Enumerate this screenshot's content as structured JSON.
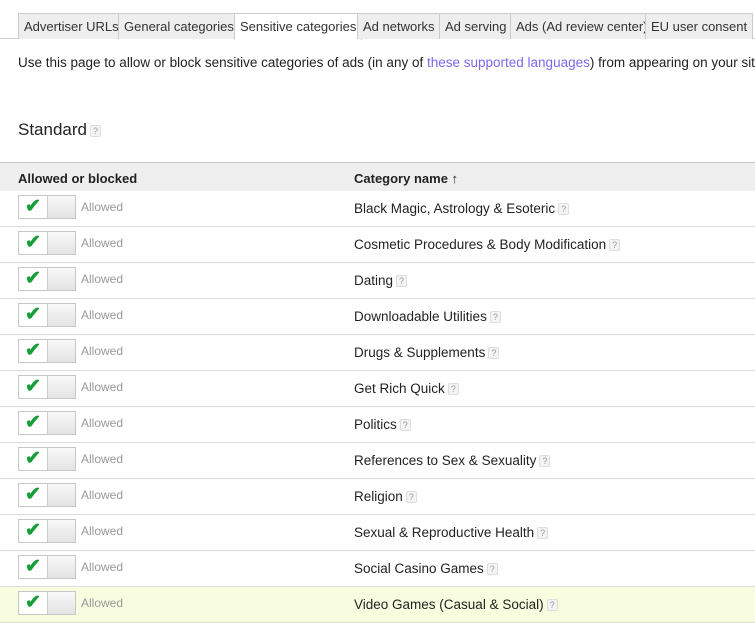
{
  "tabs": [
    {
      "label": "Advertiser URLs",
      "active": false
    },
    {
      "label": "General categories",
      "active": false
    },
    {
      "label": "Sensitive categories",
      "active": true
    },
    {
      "label": "Ad networks",
      "active": false
    },
    {
      "label": "Ad serving",
      "active": false
    },
    {
      "label": "Ads (Ad review center)",
      "active": false
    },
    {
      "label": "EU user consent",
      "active": false
    }
  ],
  "intro": {
    "before": "Use this page to allow or block sensitive categories of ads (in any of ",
    "link": "these supported languages",
    "after": ") from appearing on your site."
  },
  "section_title": "Standard",
  "help_glyph": "?",
  "table": {
    "col_status": "Allowed or blocked",
    "col_category": "Category name",
    "sort_arrow": "↑",
    "rows": [
      {
        "status": "Allowed",
        "category": "Black Magic, Astrology & Esoteric"
      },
      {
        "status": "Allowed",
        "category": "Cosmetic Procedures & Body Modification"
      },
      {
        "status": "Allowed",
        "category": "Dating"
      },
      {
        "status": "Allowed",
        "category": "Downloadable Utilities"
      },
      {
        "status": "Allowed",
        "category": "Drugs & Supplements"
      },
      {
        "status": "Allowed",
        "category": "Get Rich Quick"
      },
      {
        "status": "Allowed",
        "category": "Politics"
      },
      {
        "status": "Allowed",
        "category": "References to Sex & Sexuality"
      },
      {
        "status": "Allowed",
        "category": "Religion"
      },
      {
        "status": "Allowed",
        "category": "Sexual & Reproductive Health"
      },
      {
        "status": "Allowed",
        "category": "Social Casino Games"
      },
      {
        "status": "Allowed",
        "category": "Video Games (Casual & Social)"
      }
    ]
  },
  "colors": {
    "check": "#1a9e3a",
    "link": "#7b68ee",
    "highlight_row": "#f8fde0"
  }
}
